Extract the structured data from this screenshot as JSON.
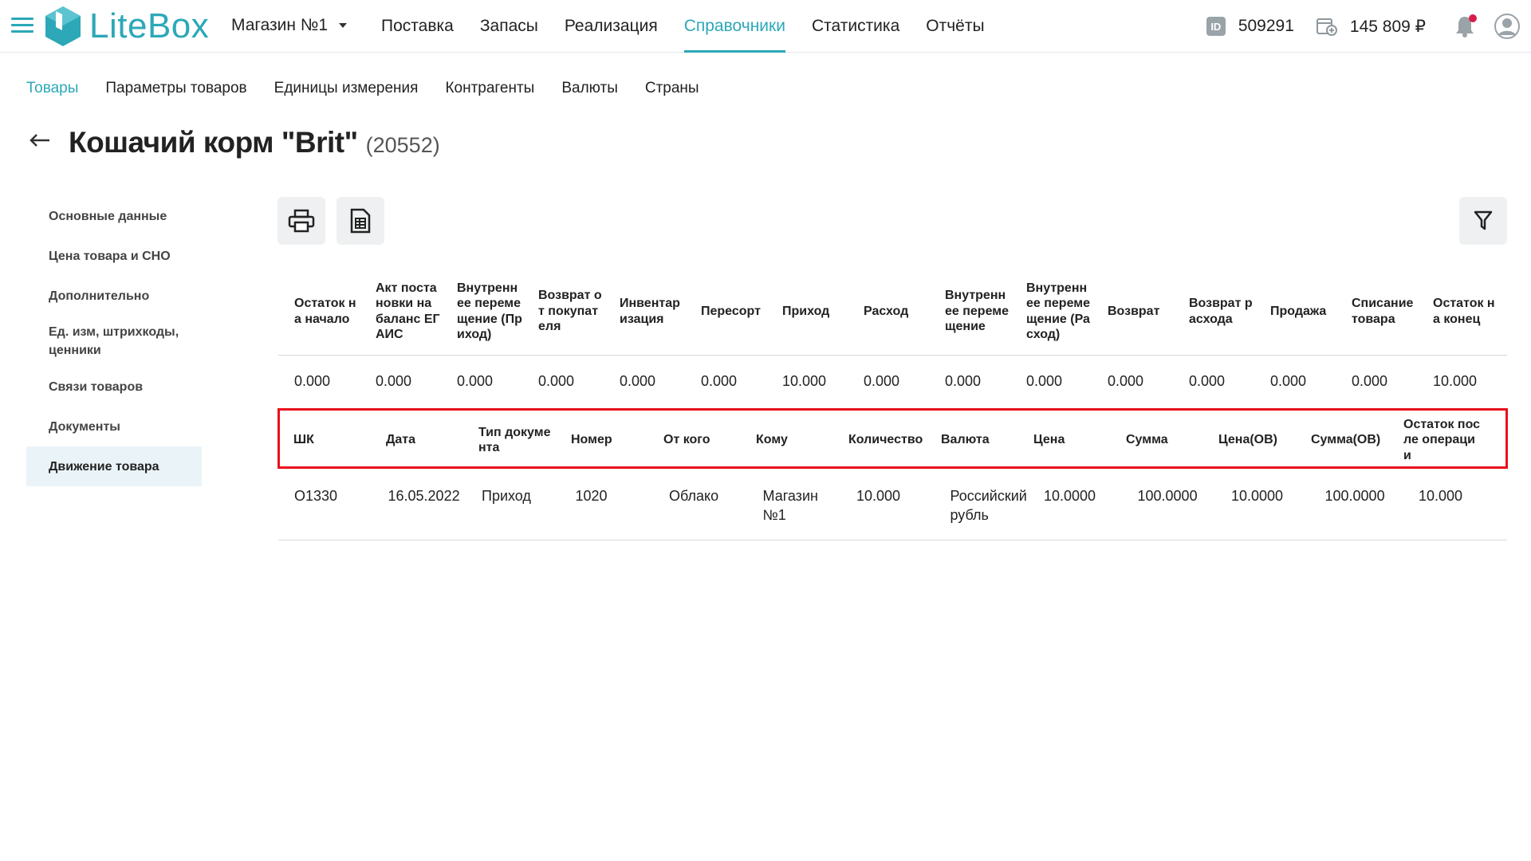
{
  "header": {
    "logo_text": "LiteBox",
    "store_name": "Магазин №1",
    "nav": [
      {
        "label": "Поставка",
        "active": false
      },
      {
        "label": "Запасы",
        "active": false
      },
      {
        "label": "Реализация",
        "active": false
      },
      {
        "label": "Справочники",
        "active": true
      },
      {
        "label": "Статистика",
        "active": false
      },
      {
        "label": "Отчёты",
        "active": false
      }
    ],
    "id_badge": "ID",
    "account_id": "509291",
    "balance": "145 809 ₽"
  },
  "subnav": [
    {
      "label": "Товары",
      "active": true
    },
    {
      "label": "Параметры товаров",
      "active": false
    },
    {
      "label": "Единицы измерения",
      "active": false
    },
    {
      "label": "Контрагенты",
      "active": false
    },
    {
      "label": "Валюты",
      "active": false
    },
    {
      "label": "Страны",
      "active": false
    }
  ],
  "page": {
    "title": "Кошачий корм \"Brit\"",
    "code": "(20552)"
  },
  "left_menu": [
    {
      "label": "Основные данные",
      "active": false
    },
    {
      "label": "Цена товара и СНО",
      "active": false
    },
    {
      "label": "Дополнительно",
      "active": false
    },
    {
      "label": "Ед. изм, штрихкоды, ценники",
      "active": false
    },
    {
      "label": "Связи товаров",
      "active": false
    },
    {
      "label": "Документы",
      "active": false
    },
    {
      "label": "Движение товара",
      "active": true
    }
  ],
  "summary": {
    "headers": [
      "Остаток на начало",
      "Акт постановки на баланс ЕГАИС",
      "Внутреннее перемещение (Приход)",
      "Возврат от покупателя",
      "Инвентаризация",
      "Пересорт",
      "Приход",
      "Расход",
      "Внутреннее перемещение",
      "Внутреннее перемещение (Расход)",
      "Возврат",
      "Возврат расхода",
      "Продажа",
      "Списание товара",
      "Остаток на конец"
    ],
    "values": [
      "0.000",
      "0.000",
      "0.000",
      "0.000",
      "0.000",
      "0.000",
      "10.000",
      "0.000",
      "0.000",
      "0.000",
      "0.000",
      "0.000",
      "0.000",
      "0.000",
      "10.000"
    ]
  },
  "movement": {
    "headers": [
      "ШК",
      "Дата",
      "Тип документа",
      "Номер",
      "От кого",
      "Кому",
      "Количество",
      "Валюта",
      "Цена",
      "Сумма",
      "Цена(ОВ)",
      "Сумма(ОВ)",
      "Остаток после операции"
    ],
    "rows": [
      [
        "О1330",
        "16.05.2022",
        "Приход",
        "1020",
        "Облако",
        "Магазин №1",
        "10.000",
        "Российский рубль",
        "10.0000",
        "100.0000",
        "10.0000",
        "100.0000",
        "10.000"
      ]
    ]
  },
  "colors": {
    "accent": "#2ca8b8",
    "highlight": "#e8111d",
    "active_menu_bg": "#eaf4f8"
  },
  "icons": {
    "menu": "hamburger-icon",
    "print": "printer-icon",
    "export": "spreadsheet-icon",
    "filter": "filter-icon",
    "back": "arrow-left-icon",
    "notifications": "bell-icon",
    "profile": "user-avatar-icon"
  }
}
